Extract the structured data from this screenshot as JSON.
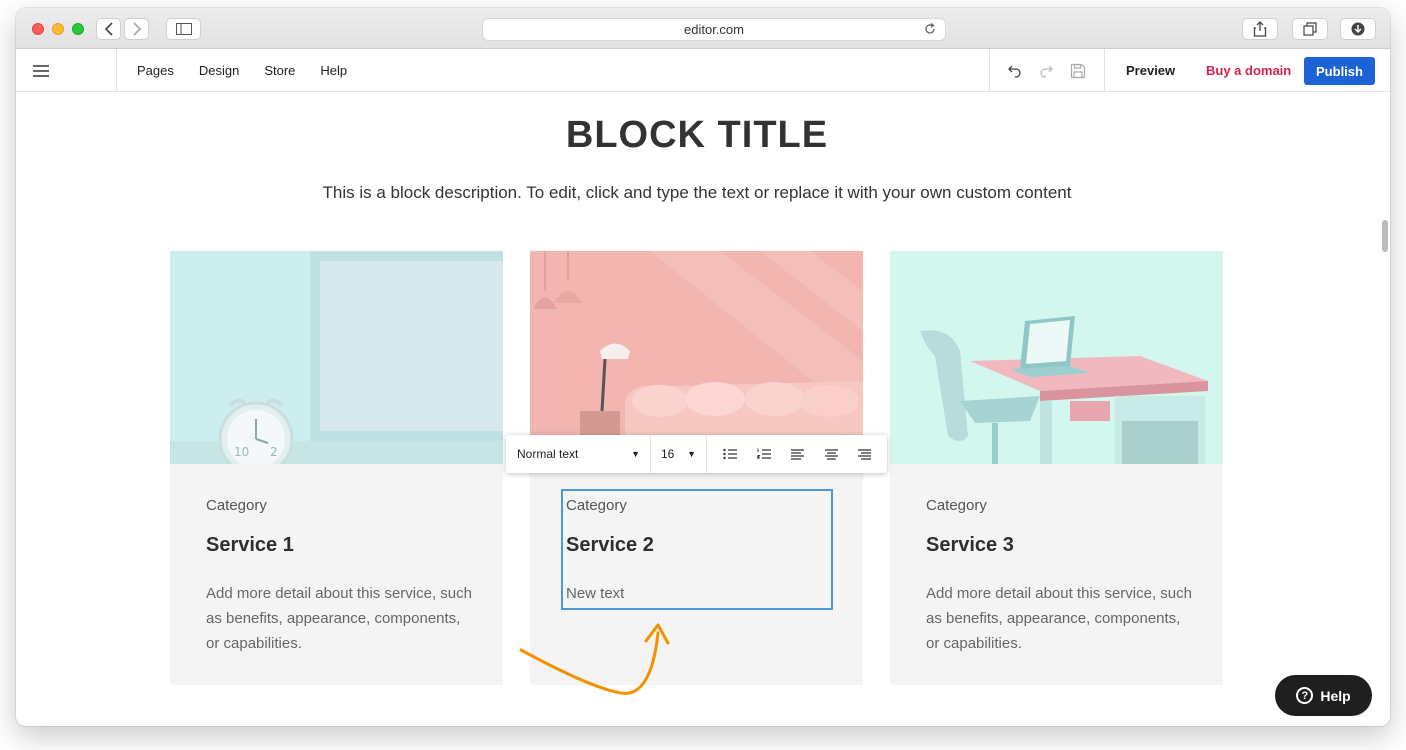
{
  "browser": {
    "url": "editor.com"
  },
  "editor_bar": {
    "nav": [
      "Pages",
      "Design",
      "Store",
      "Help"
    ],
    "preview_label": "Preview",
    "buy_domain_label": "Buy a domain",
    "publish_label": "Publish"
  },
  "block": {
    "title": "BLOCK TITLE",
    "description": "This is a block description. To edit, click and type the text or replace it with your own custom content"
  },
  "cards": [
    {
      "category": "Category",
      "title": "Service 1",
      "text": "Add more detail about this service, such as benefits, appearance, components, or capabilities."
    },
    {
      "category": "Category",
      "title": "Service 2",
      "text": "New text"
    },
    {
      "category": "Category",
      "title": "Service 3",
      "text": "Add more detail about this service, such as benefits, appearance, components, or capabilities."
    }
  ],
  "format_toolbar": {
    "text_style": "Normal text",
    "font_size": "16"
  },
  "help_button": {
    "label": "Help"
  },
  "colors": {
    "publish_blue": "#1e63d6",
    "buy_domain_red": "#d6204f",
    "selection_blue": "#4a9ad8",
    "arrow_orange": "#f39200"
  }
}
